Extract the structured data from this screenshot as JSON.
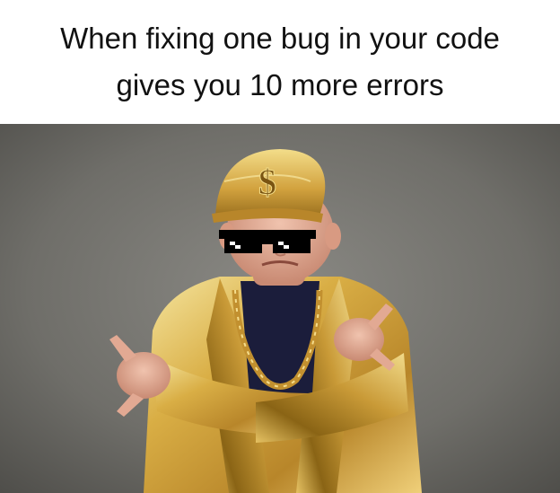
{
  "meme": {
    "caption_line1": "When fixing one bug in your code",
    "caption_line2": "gives you 10 more errors",
    "cap_symbol": "$"
  },
  "colors": {
    "background": "#ffffff",
    "caption_text": "#111111",
    "wall": "#6f6e69",
    "gold": "#d9ae45",
    "gold_highlight": "#f6e7a2",
    "gold_shadow": "#8a6415",
    "shirt": "#1b1d3b",
    "skin": "#e2a993",
    "glasses": "#000000"
  },
  "icons": [
    "dollar-sign-icon",
    "pixel-sunglasses-icon",
    "gold-chain-icon"
  ]
}
